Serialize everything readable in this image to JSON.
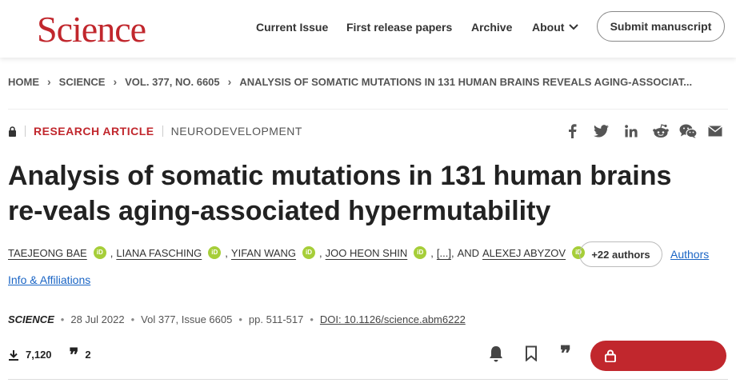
{
  "header": {
    "logo": "Science",
    "nav": [
      "Current Issue",
      "First release papers",
      "Archive",
      "About"
    ],
    "submit_label": "Submit manuscript"
  },
  "breadcrumb": [
    "HOME",
    "SCIENCE",
    "VOL. 377, NO. 6605",
    "ANALYSIS OF SOMATIC MUTATIONS IN 131 HUMAN BRAINS REVEALS AGING-ASSOCIAT..."
  ],
  "article": {
    "type": "RESEARCH ARTICLE",
    "section": "NEURODEVELOPMENT",
    "title": "Analysis of somatic mutations in 131 human brains re-veals aging-associated hypermutability",
    "authors": [
      "TAEJEONG BAE",
      "LIANA FASCHING",
      "YIFAN WANG",
      "JOO HEON SHIN"
    ],
    "ellipsis": "[...]",
    "and_label": "AND",
    "last_author": "ALEXEJ ABYZOV",
    "orcid_label": "iD",
    "more_authors": "+22 authors",
    "authors_link": "Authors",
    "info_link": "Info & Affiliations"
  },
  "citation": {
    "journal": "SCIENCE",
    "date": "28 Jul 2022",
    "volume": "Vol 377, Issue 6605",
    "pages": "pp. 511-517",
    "doi": "DOI: 10.1126/science.abm6222"
  },
  "stats": {
    "downloads": "7,120",
    "citations": "2"
  },
  "icons": {
    "share": [
      "facebook-icon",
      "twitter-icon",
      "linkedin-icon",
      "reddit-icon",
      "wechat-icon",
      "email-icon"
    ]
  },
  "colors": {
    "brand": "#c1272d",
    "link": "#1a65c5",
    "orcid": "#a6ce39"
  }
}
